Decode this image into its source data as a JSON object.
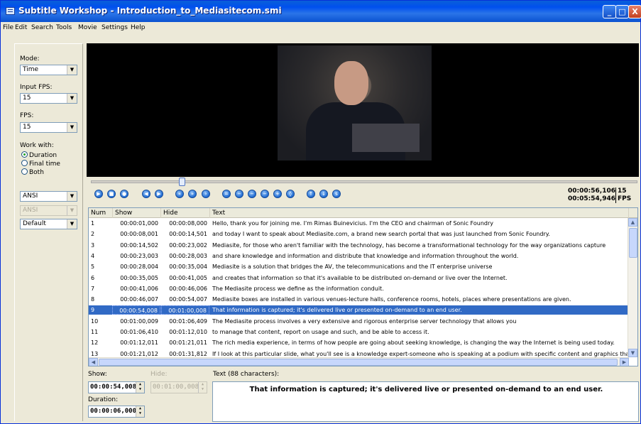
{
  "window": {
    "title": "Subtitle Workshop - Introduction_to_Mediasitecom.smi",
    "min_label": "_",
    "max_label": "□",
    "close_label": "X"
  },
  "menu": [
    "File",
    "Edit",
    "Search",
    "Tools",
    "Movie",
    "Settings",
    "Help"
  ],
  "left_panel": {
    "mode_label": "Mode:",
    "mode_value": "Time",
    "input_fps_label": "Input FPS:",
    "input_fps_value": "15",
    "fps_label": "FPS:",
    "fps_value": "15",
    "work_with_label": "Work with:",
    "work_options": [
      "Duration",
      "Final time",
      "Both"
    ],
    "work_selected": "Duration",
    "charset1": "ANSI",
    "charset2": "ANSI",
    "style": "Default"
  },
  "player": {
    "current_time": "00:00:56,106",
    "total_time": "00:05:54,946",
    "fps_value": "15",
    "fps_unit": "FPS",
    "seek_position_fraction": 0.16
  },
  "grid": {
    "columns": [
      "Num",
      "Show",
      "Hide",
      "Text"
    ],
    "selected_row": 9,
    "rows": [
      {
        "num": "1",
        "show": "00:00:01,000",
        "hide": "00:00:08,000",
        "text": "Hello, thank you for joining me. I'm Rimas Buinevicius. I'm the CEO and chairman of Sonic Foundry"
      },
      {
        "num": "2",
        "show": "00:00:08,001",
        "hide": "00:00:14,501",
        "text": "and today I want to speak about Mediasite.com, a brand new search portal that was just launched from Sonic Foundry."
      },
      {
        "num": "3",
        "show": "00:00:14,502",
        "hide": "00:00:23,002",
        "text": "Mediasite, for those who aren't familiar with the technology, has become a transformational technology for the way organizations capture"
      },
      {
        "num": "4",
        "show": "00:00:23,003",
        "hide": "00:00:28,003",
        "text": "and share knowledge and information and distribute that knowledge and information throughout the world."
      },
      {
        "num": "5",
        "show": "00:00:28,004",
        "hide": "00:00:35,004",
        "text": "Mediasite is a solution that bridges the AV, the telecommunications and the IT enterprise universe"
      },
      {
        "num": "6",
        "show": "00:00:35,005",
        "hide": "00:00:41,005",
        "text": "and creates that information so that it's available to be distributed on-demand or live over the Internet."
      },
      {
        "num": "7",
        "show": "00:00:41,006",
        "hide": "00:00:46,006",
        "text": "The Mediasite process we define as the information conduit."
      },
      {
        "num": "8",
        "show": "00:00:46,007",
        "hide": "00:00:54,007",
        "text": "Mediasite boxes are installed in various venues-lecture halls, conference rooms, hotels, places where presentations are given."
      },
      {
        "num": "9",
        "show": "00:00:54,008",
        "hide": "00:01:00,008",
        "text": "That information is captured; it's delivered live or presented on-demand to an end user."
      },
      {
        "num": "10",
        "show": "00:01:00,009",
        "hide": "00:01:06,409",
        "text": "The Mediasite process involves a very extensive and rigorous enterprise server technology that allows you"
      },
      {
        "num": "11",
        "show": "00:01:06,410",
        "hide": "00:01:12,010",
        "text": "to manage that content, report on usage and such, and be able to access it."
      },
      {
        "num": "12",
        "show": "00:01:12,011",
        "hide": "00:01:21,011",
        "text": "The rich media experience, in terms of how people are going about seeking knowledge, is changing the way the Internet is being used today."
      },
      {
        "num": "13",
        "show": "00:01:21,012",
        "hide": "00:01:31,812",
        "text": "If I look at this particular slide, what you'll see is a knowledge expert-someone who is speaking at a podium with specific content and graphics that"
      }
    ]
  },
  "editor": {
    "show_label": "Show:",
    "show_value": "00:00:54,008",
    "hide_label": "Hide:",
    "hide_value": "00:01:00,008",
    "duration_label": "Duration:",
    "duration_value": "00:00:06,000",
    "text_label": "Text (88 characters):",
    "text_value": "That information is captured; it's delivered live or presented on-demand to an end user."
  }
}
